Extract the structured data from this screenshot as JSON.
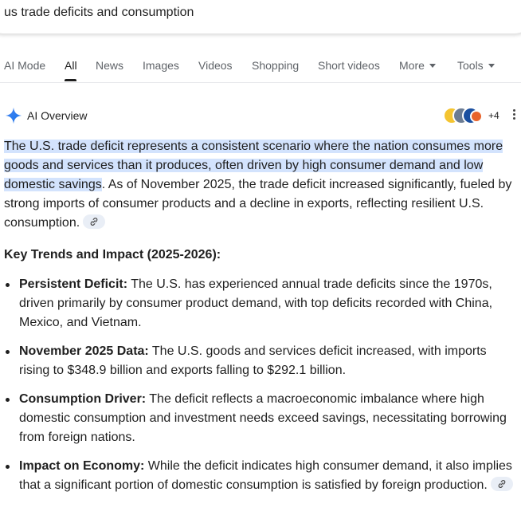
{
  "search": {
    "query": "us trade deficits and consumption"
  },
  "tabs": [
    {
      "label": "AI Mode"
    },
    {
      "label": "All"
    },
    {
      "label": "News"
    },
    {
      "label": "Images"
    },
    {
      "label": "Videos"
    },
    {
      "label": "Shopping"
    },
    {
      "label": "Short videos"
    },
    {
      "label": "More"
    },
    {
      "label": "Tools"
    }
  ],
  "active_tab": "All",
  "ai_overview": {
    "title": "AI Overview",
    "sources_more": "+4",
    "intro_highlighted": "The U.S. trade deficit represents a consistent scenario where the nation consumes more goods and services than it produces, often driven by high consumer demand and low domestic savings",
    "intro_rest": ". As of November 2025, the trade deficit increased significantly, fueled by strong imports of consumer products and a decline in exports, reflecting resilient U.S. consumption.",
    "section_heading": "Key Trends and Impact (2025-2026):",
    "bullets": [
      {
        "term": "Persistent Deficit:",
        "text": " The U.S. has experienced annual trade deficits since the 1970s, driven primarily by consumer product demand, with top deficits recorded with China, Mexico, and Vietnam."
      },
      {
        "term": "November 2025 Data:",
        "text": " The U.S. goods and services deficit increased, with imports rising to $348.9 billion and exports falling to $292.1 billion."
      },
      {
        "term": "Consumption Driver:",
        "text": " The deficit reflects a macroeconomic imbalance where high domestic consumption and investment needs exceed savings, necessitating borrowing from foreign nations."
      },
      {
        "term": "Impact on Economy:",
        "text": " While the deficit indicates high consumer demand, it also implies that a significant portion of domestic consumption is satisfied by foreign production."
      }
    ]
  },
  "colors": {
    "highlight": "#d3e3fd",
    "chip": "#e9eef6",
    "sparkle": "#4285f4"
  },
  "icons": [
    "sparkle-icon",
    "link-icon",
    "more-vert-icon",
    "caret-down-icon"
  ]
}
